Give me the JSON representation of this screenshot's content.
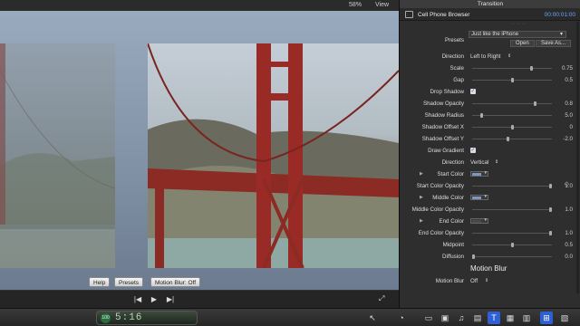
{
  "viewer": {
    "zoom": "58%",
    "view_label": "View",
    "buttons": {
      "help": "Help",
      "presets": "Presets",
      "motion_blur": "Motion Blur: Off"
    }
  },
  "transport": {
    "prev": "|◀",
    "play": "▶",
    "next": "▶|"
  },
  "timecode": {
    "badge": "100",
    "value": "5:16"
  },
  "inspector": {
    "title": "Transition",
    "name": "Cell Phone Browser",
    "duration": "00:00:01:00",
    "presets_label": "Presets",
    "preset_value": "Just like the iPhone",
    "open_label": "Open",
    "save_as_label": "Save As...",
    "params": {
      "direction": {
        "label": "Direction",
        "value": "Left to Right"
      },
      "scale": {
        "label": "Scale",
        "value": "0.75",
        "level": 0.75
      },
      "gap": {
        "label": "Gap",
        "value": "0.5",
        "level": 0.5
      },
      "drop_shadow": {
        "label": "Drop Shadow",
        "checked": true
      },
      "shadow_opacity": {
        "label": "Shadow Opacity",
        "value": "0.8",
        "level": 0.8
      },
      "shadow_radius": {
        "label": "Shadow Radius",
        "value": "5.0",
        "level": 0.1
      },
      "shadow_offset_x": {
        "label": "Shadow Offset X",
        "value": "0",
        "level": 0.5
      },
      "shadow_offset_y": {
        "label": "Shadow Offset Y",
        "value": "-2.0",
        "level": 0.45
      },
      "draw_gradient": {
        "label": "Draw Gradient",
        "checked": true
      },
      "gradient_direction": {
        "label": "Direction",
        "value": "Vertical"
      },
      "start_color": {
        "label": "Start Color",
        "color": "#7a97c2"
      },
      "start_color_opacity": {
        "label": "Start Color Opacity",
        "value": "1.0",
        "level": 1.0
      },
      "middle_color": {
        "label": "Middle Color",
        "color": "#7a97c2"
      },
      "middle_color_opacity": {
        "label": "Middle Color Opacity",
        "value": "1.0",
        "level": 1.0
      },
      "end_color": {
        "label": "End Color",
        "color": "#4a4a4a"
      },
      "end_color_opacity": {
        "label": "End Color Opacity",
        "value": "1.0",
        "level": 1.0
      },
      "midpoint": {
        "label": "Midpoint",
        "value": "0.5",
        "level": 0.5
      },
      "diffusion": {
        "label": "Diffusion",
        "value": "0.0",
        "level": 0.0
      }
    },
    "motion_blur_section": "Motion Blur",
    "motion_blur": {
      "label": "Motion Blur",
      "value": "Off"
    }
  },
  "colors": {
    "accent": "#2f5fd0",
    "timecode_green": "#b8d6b8",
    "duration_blue": "#6aa6ff"
  }
}
